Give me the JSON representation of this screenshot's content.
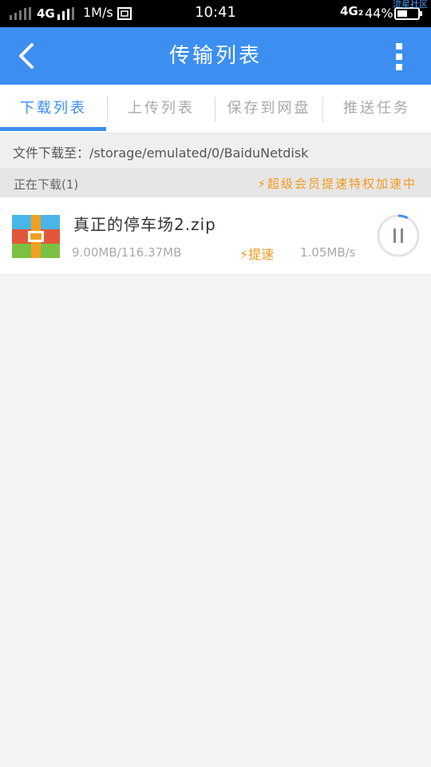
{
  "status_bar": {
    "network": "4G",
    "speed": "1M/s",
    "time": "10:41",
    "network_right": "4G₂",
    "battery": "44%",
    "watermark": "流星社区"
  },
  "header": {
    "title": "传输列表",
    "back_icon": "chevron-left-icon",
    "more_icon": "more-vertical-icon"
  },
  "tabs": [
    {
      "label": "下载列表",
      "active": true
    },
    {
      "label": "上传列表",
      "active": false
    },
    {
      "label": "保存到网盘",
      "active": false
    },
    {
      "label": "推送任务",
      "active": false
    }
  ],
  "path": "文件下载至：/storage/emulated/0/BaiduNetdisk",
  "downloading": {
    "title": "正在下载(1)",
    "vip_text": "⚡超级会员提速特权加速中"
  },
  "items": [
    {
      "name": "真正的停车场2.zip",
      "size": "9.00MB/116.37MB",
      "boost": "⚡提速",
      "speed": "1.05MB/s",
      "progress": 0.077,
      "icon": "zip-file-icon",
      "action_icon": "pause-icon"
    }
  ],
  "colors": {
    "accent": "#3c8ff0",
    "vip": "#f29a1f"
  }
}
